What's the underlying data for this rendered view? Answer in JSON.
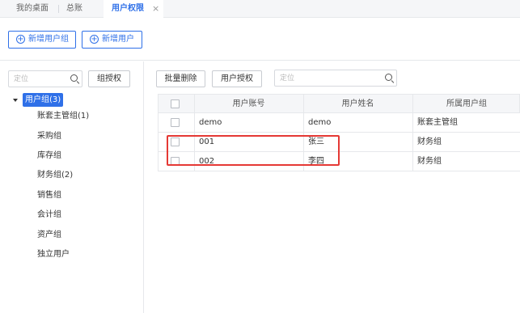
{
  "tabs": [
    {
      "label": "我的桌面"
    },
    {
      "label": "总账"
    },
    {
      "label": "用户权限",
      "active": true
    }
  ],
  "tab_close_glyph": "×",
  "actions": {
    "add_group": "新增用户组",
    "add_user": "新增用户"
  },
  "left": {
    "search_placeholder": "定位",
    "auth_button": "组授权",
    "tree_root": "用户组(3)",
    "tree_items": [
      "账套主管组(1)",
      "采购组",
      "库存组",
      "财务组(2)",
      "销售组",
      "会计组",
      "资产组",
      "独立用户"
    ]
  },
  "right": {
    "batch_delete": "批量删除",
    "user_auth": "用户授权",
    "search_placeholder": "定位",
    "columns": [
      "用户账号",
      "用户姓名",
      "所属用户组"
    ],
    "rows": [
      {
        "account": "demo",
        "name": "demo",
        "group": "账套主管组"
      },
      {
        "account": "001",
        "name": "张三",
        "group": "财务组"
      },
      {
        "account": "002",
        "name": "李四",
        "group": "财务组"
      }
    ]
  },
  "colors": {
    "accent": "#2f70e8",
    "highlight": "#e53935"
  },
  "icons": {
    "search": "search-icon",
    "plus": "plus-circle-icon",
    "caret": "caret-down-icon",
    "close": "close-icon"
  }
}
